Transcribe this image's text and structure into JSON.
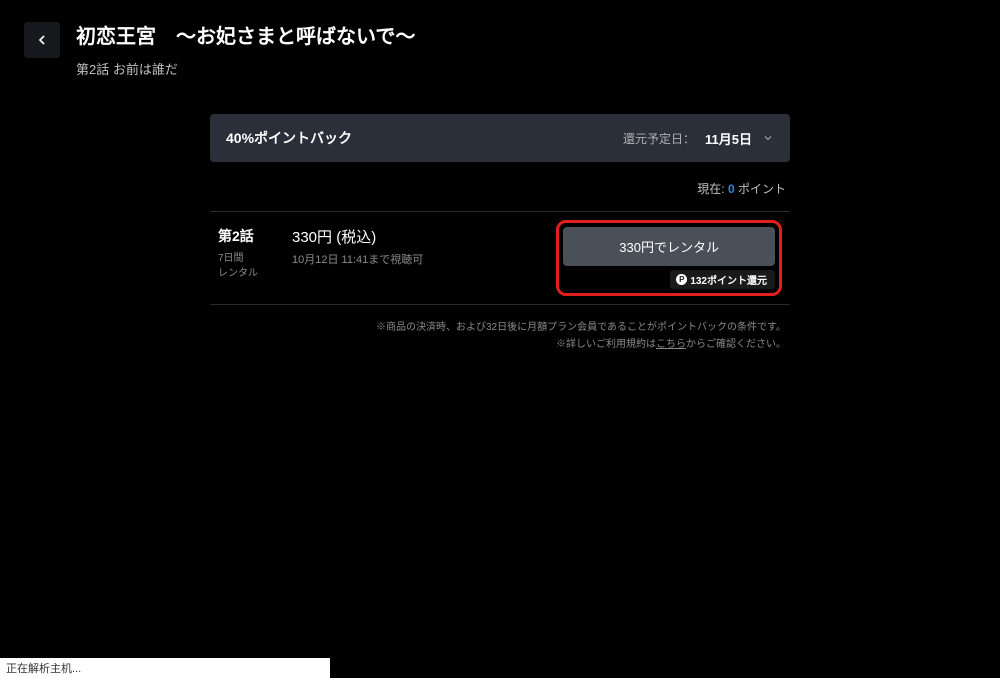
{
  "header": {
    "title": "初恋王宮　〜お妃さまと呼ばないで〜",
    "subtitle": "第2話 お前は誰だ"
  },
  "pointback": {
    "label": "40%ポイントバック",
    "return_date_label": "還元予定日：",
    "return_date": "11月5日"
  },
  "points_status": {
    "prefix": "現在: ",
    "value": "0",
    "suffix": " ポイント"
  },
  "rental": {
    "episode_number": "第2話",
    "duration": "7日間",
    "type": "レンタル",
    "price": "330円 (税込)",
    "expiry": "10月12日 11:41まで視聴可",
    "button_label": "330円でレンタル",
    "point_return_text": "132ポイント還元",
    "point_icon_glyph": "P"
  },
  "footer": {
    "note1": "※商品の決済時、および32日後に月額プラン会員であることがポイントバックの条件です。",
    "note2_prefix": "※詳しいご利用規約は",
    "note2_link": "こちら",
    "note2_suffix": "からご確認ください。"
  },
  "status_bar": {
    "text": "正在解析主机..."
  }
}
